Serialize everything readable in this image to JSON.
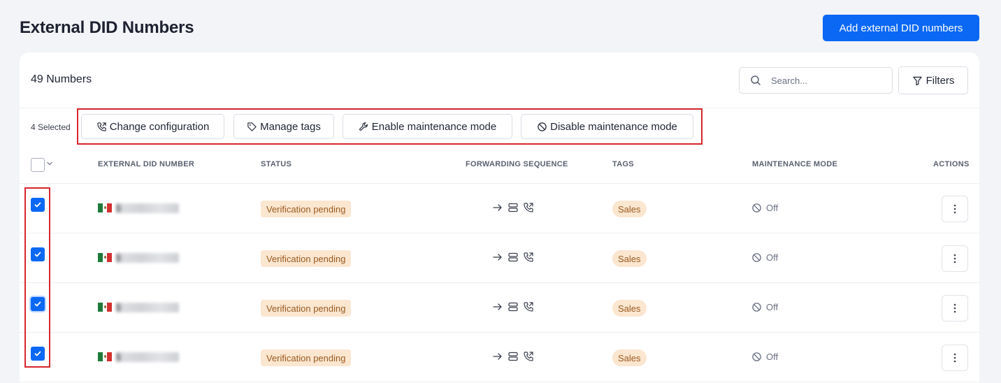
{
  "page": {
    "title": "External DID Numbers",
    "add_button": "Add external DID numbers"
  },
  "toolbar": {
    "count_label": "49 Numbers",
    "search_placeholder": "Search...",
    "filters_label": "Filters"
  },
  "bulk": {
    "selected_label": "4 Selected",
    "actions": [
      {
        "label": "Change configuration",
        "icon": "phone-forward-icon"
      },
      {
        "label": "Manage tags",
        "icon": "tag-icon"
      },
      {
        "label": "Enable maintenance mode",
        "icon": "wrench-icon"
      },
      {
        "label": "Disable maintenance mode",
        "icon": "ban-icon"
      }
    ]
  },
  "table": {
    "columns": [
      "EXTERNAL DID NUMBER",
      "STATUS",
      "FORWARDING SEQUENCE",
      "TAGS",
      "MAINTENANCE MODE",
      "ACTIONS"
    ],
    "rows": [
      {
        "checked": true,
        "number_prefix": "5",
        "country_flag": "mexico-flag-icon",
        "status": "Verification pending",
        "tag": "Sales",
        "maintenance": "Off"
      },
      {
        "checked": true,
        "number_prefix": "5",
        "country_flag": "mexico-flag-icon",
        "status": "Verification pending",
        "tag": "Sales",
        "maintenance": "Off"
      },
      {
        "checked": true,
        "number_prefix": "5",
        "country_flag": "mexico-flag-icon",
        "status": "Verification pending",
        "tag": "Sales",
        "maintenance": "Off"
      },
      {
        "checked": true,
        "number_prefix": "5",
        "country_flag": "mexico-flag-icon",
        "status": "Verification pending",
        "tag": "Sales",
        "maintenance": "Off"
      }
    ]
  },
  "colors": {
    "accent": "#0a68f5",
    "badge_bg": "#fbe6d0",
    "badge_text": "#9a5a20",
    "highlight": "#d7262c"
  }
}
